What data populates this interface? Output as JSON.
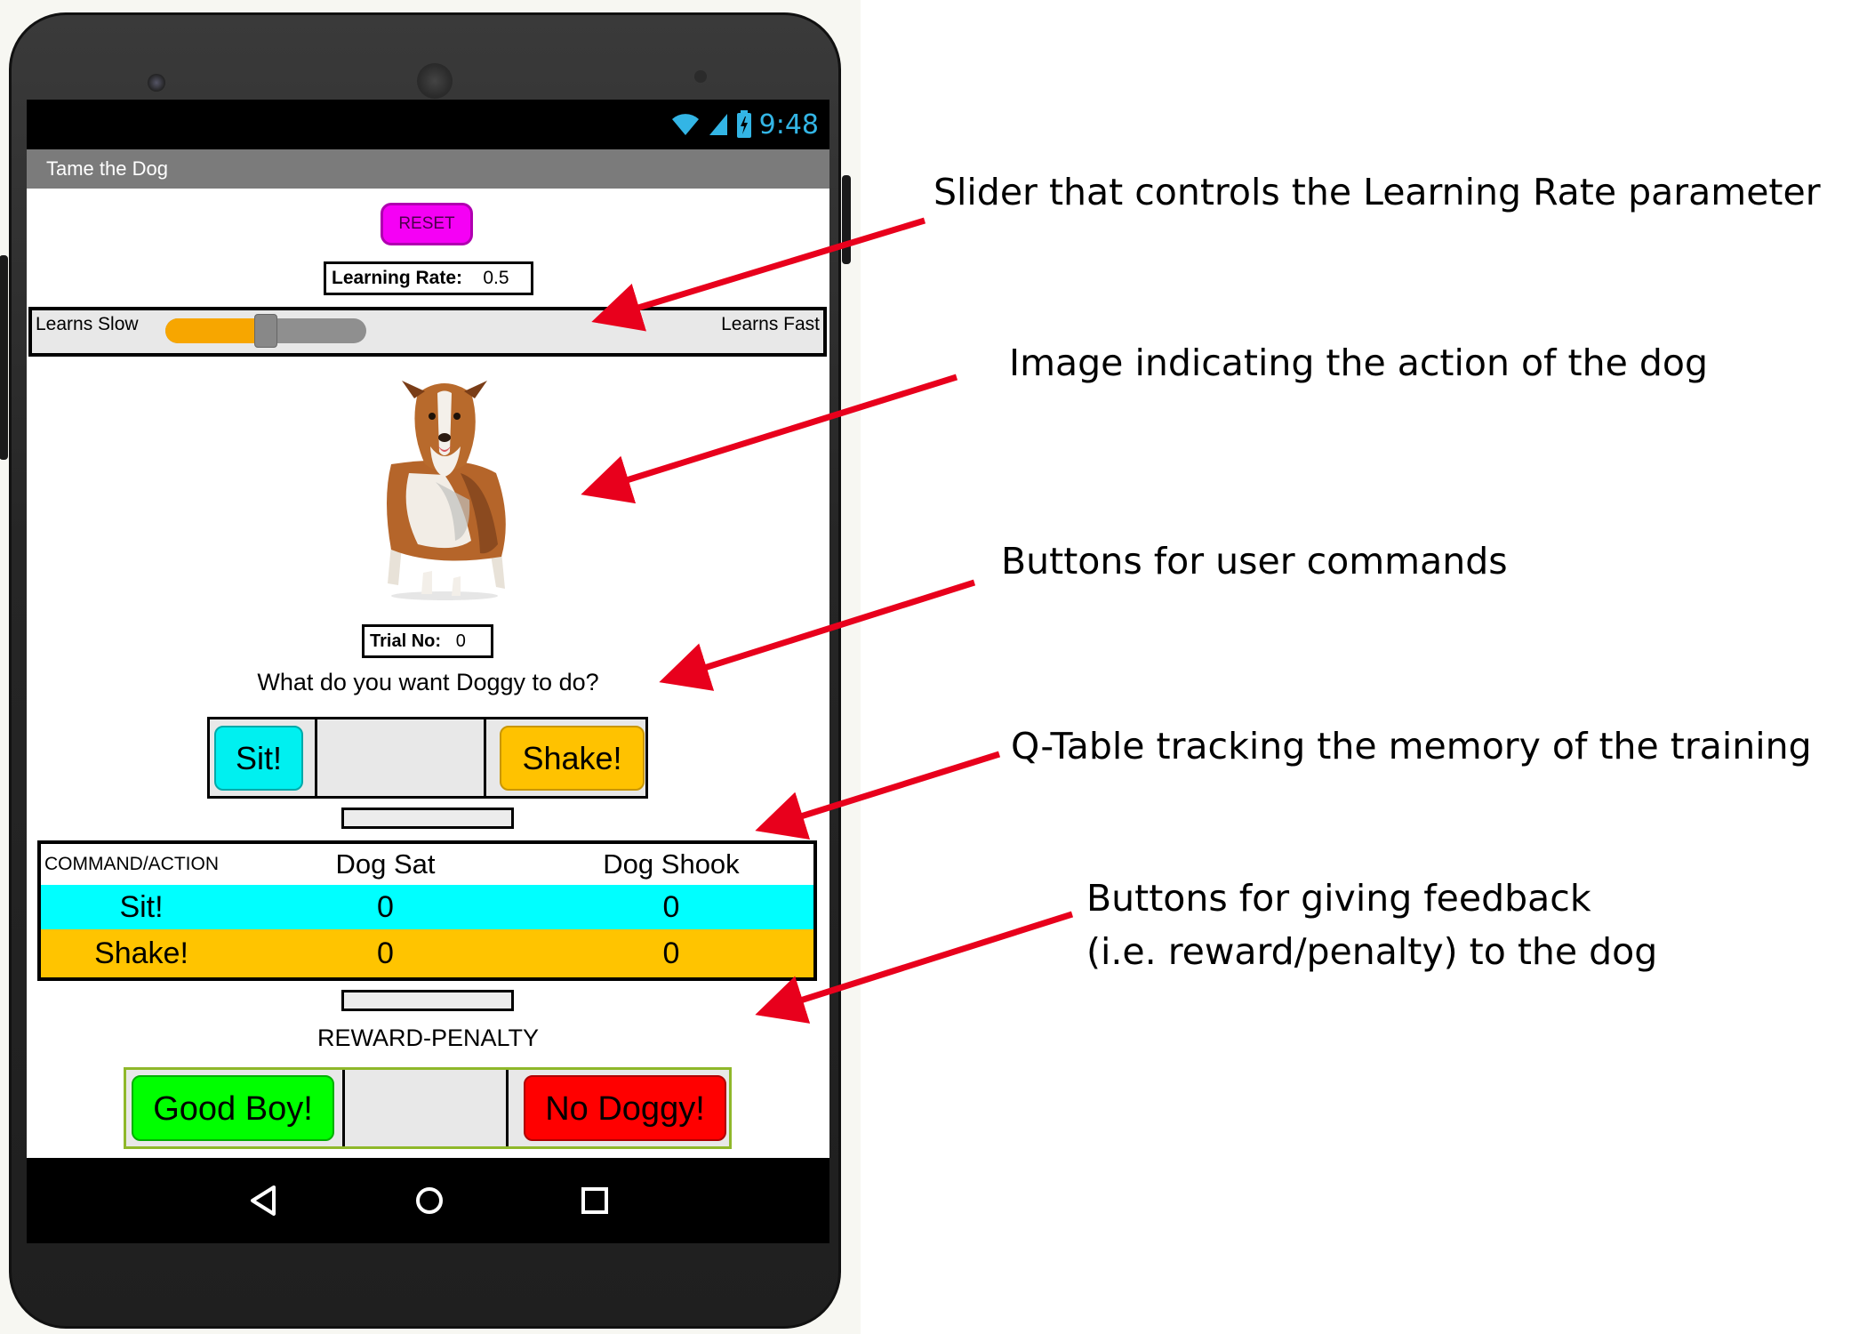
{
  "status_bar": {
    "time": "9:48"
  },
  "app": {
    "title": "Tame the Dog",
    "reset_label": "RESET",
    "learning_rate": {
      "label": "Learning Rate:",
      "value": "0.5"
    },
    "slider": {
      "left_label": "Learns Slow",
      "right_label": "Learns Fast",
      "level_fraction": 0.5
    },
    "trial": {
      "label": "Trial No:",
      "value": "0"
    },
    "prompt": "What do you want Doggy to do?",
    "commands": {
      "sit_label": "Sit!",
      "shake_label": "Shake!"
    },
    "qtable": {
      "headers": [
        "COMMAND/ACTION",
        "Dog Sat",
        "Dog Shook"
      ],
      "rows": [
        {
          "command": "Sit!",
          "dog_sat": "0",
          "dog_shook": "0"
        },
        {
          "command": "Shake!",
          "dog_sat": "0",
          "dog_shook": "0"
        }
      ]
    },
    "reward_penalty_label": "REWARD-PENALTY",
    "feedback": {
      "good_label": "Good Boy!",
      "bad_label": "No Doggy!"
    }
  },
  "annotations": {
    "slider": "Slider that controls the Learning Rate parameter",
    "image": "Image indicating the action of the dog",
    "commands": "Buttons for user commands",
    "qtable": "Q-Table tracking the memory of the training",
    "feedback_line1": "Buttons for giving feedback",
    "feedback_line2": " (i.e. reward/penalty) to the dog"
  },
  "colors": {
    "reset": "#f500f5",
    "slider_fill": "#f7a600",
    "sit": "#00ffff",
    "shake": "#ffc400",
    "good": "#00ff00",
    "bad": "#ff0000",
    "arrow": "#e8001c",
    "status_icons": "#33b5e5"
  },
  "icons": [
    "wifi-icon",
    "signal-icon",
    "battery-icon",
    "back-icon",
    "home-icon",
    "recents-icon"
  ]
}
